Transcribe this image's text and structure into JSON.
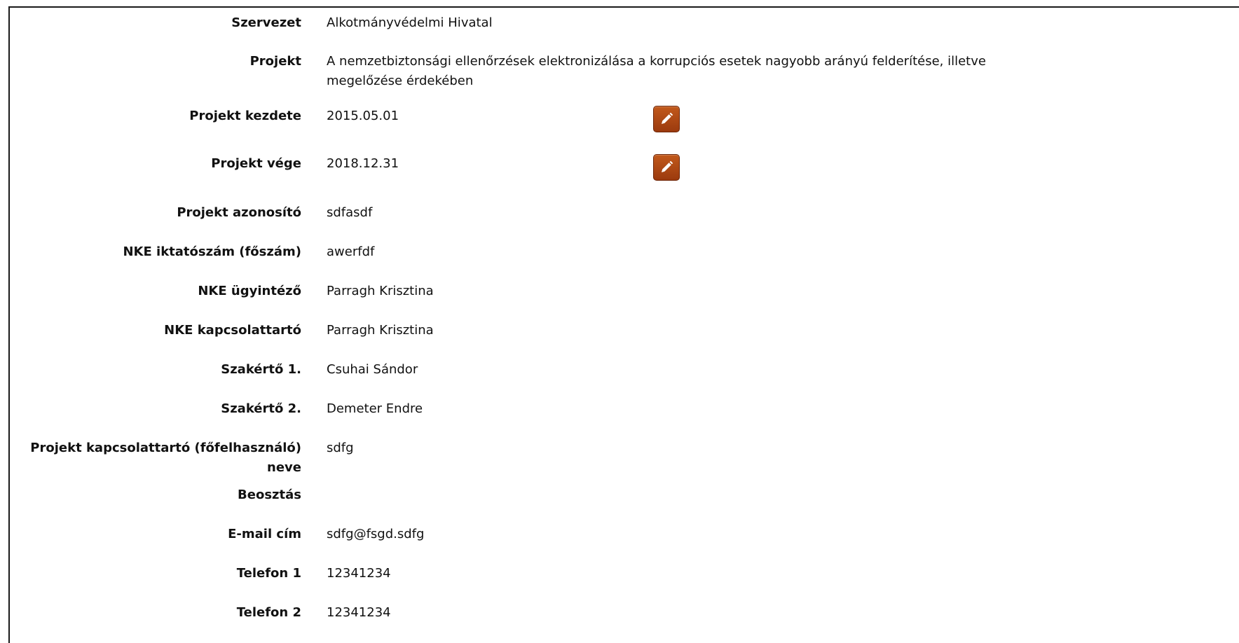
{
  "fields": [
    {
      "label": "Szervezet",
      "value": "Alkotmányvédelmi Hivatal"
    },
    {
      "label": "Projekt",
      "value": "A nemzetbiztonsági ellenőrzések elektronizálása a korrupciós esetek nagyobb arányú felderítése, illetve megelőzése érdekében"
    },
    {
      "label": "Projekt kezdete",
      "value": "2015.05.01",
      "editable": true
    },
    {
      "label": "Projekt vége",
      "value": "2018.12.31",
      "editable": true
    },
    {
      "label": "Projekt azonosító",
      "value": "sdfasdf"
    },
    {
      "label": "NKE iktatószám (főszám)",
      "value": "awerfdf"
    },
    {
      "label": "NKE ügyintéző",
      "value": "Parragh Krisztina"
    },
    {
      "label": "NKE kapcsolattartó",
      "value": "Parragh Krisztina"
    },
    {
      "label": "Szakértő 1.",
      "value": "Csuhai Sándor"
    },
    {
      "label": "Szakértő 2.",
      "value": "Demeter Endre"
    },
    {
      "label": "Projekt kapcsolattartó (főfelhasználó) neve",
      "value": "sdfg"
    },
    {
      "label": "Beosztás",
      "value": ""
    },
    {
      "label": "E-mail cím",
      "value": "sdfg@fsgd.sdfg"
    },
    {
      "label": "Telefon 1",
      "value": "12341234"
    },
    {
      "label": "Telefon 2",
      "value": "12341234"
    }
  ],
  "icons": {
    "edit": "pencil-icon",
    "button_color": "#b04a14"
  }
}
